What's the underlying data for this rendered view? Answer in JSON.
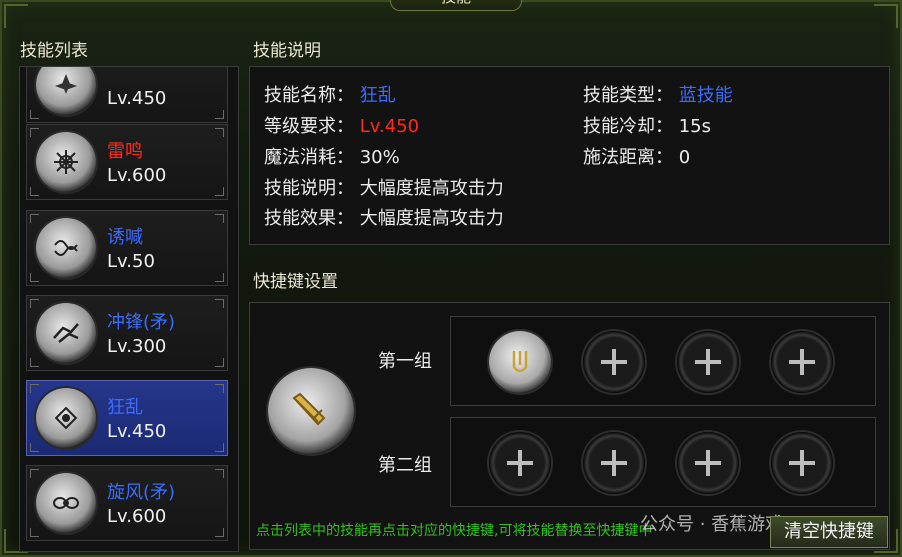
{
  "window": {
    "title": "技能"
  },
  "list": {
    "header": "技能列表",
    "items": [
      {
        "name": "",
        "level": "Lv.450",
        "name_color": "#e6e6e6",
        "icon": "lotus-icon"
      },
      {
        "name": "雷鸣",
        "level": "Lv.600",
        "name_color": "#ff2a1f",
        "icon": "thunder-icon"
      },
      {
        "name": "诱喊",
        "level": "Lv.50",
        "name_color": "#3b6bff",
        "icon": "swirl-icon"
      },
      {
        "name": "冲锋(矛)",
        "level": "Lv.300",
        "name_color": "#3b6bff",
        "icon": "charge-icon"
      },
      {
        "name": "狂乱",
        "level": "Lv.450",
        "name_color": "#3b6bff",
        "icon": "frenzy-icon"
      },
      {
        "name": "旋风(矛)",
        "level": "Lv.600",
        "name_color": "#3b6bff",
        "icon": "whirlwind-icon"
      }
    ],
    "selected_index": 4
  },
  "desc": {
    "header": "技能说明",
    "name_label": "技能名称：",
    "name_value": "狂乱",
    "req_label": "等级要求：",
    "req_value": "Lv.450",
    "mana_label": "魔法消耗：",
    "mana_value": "30%",
    "desc_label": "技能说明：",
    "desc_value": "大幅度提高攻击力",
    "effect_label": "技能效果：",
    "effect_value": "大幅度提高攻击力",
    "type_label": "技能类型：",
    "type_value": "蓝技能",
    "cd_label": "技能冷却：",
    "cd_value": "15s",
    "range_label": "施法距离：",
    "range_value": "0"
  },
  "hotkeys": {
    "header": "快捷键设置",
    "group1_label": "第一组",
    "group2_label": "第二组",
    "hint": "点击列表中的技能再点击对应的快捷键,可将技能替换至快捷键中",
    "clear_button": "清空快捷键"
  },
  "watermark": "公众号 · 香蕉游戏"
}
